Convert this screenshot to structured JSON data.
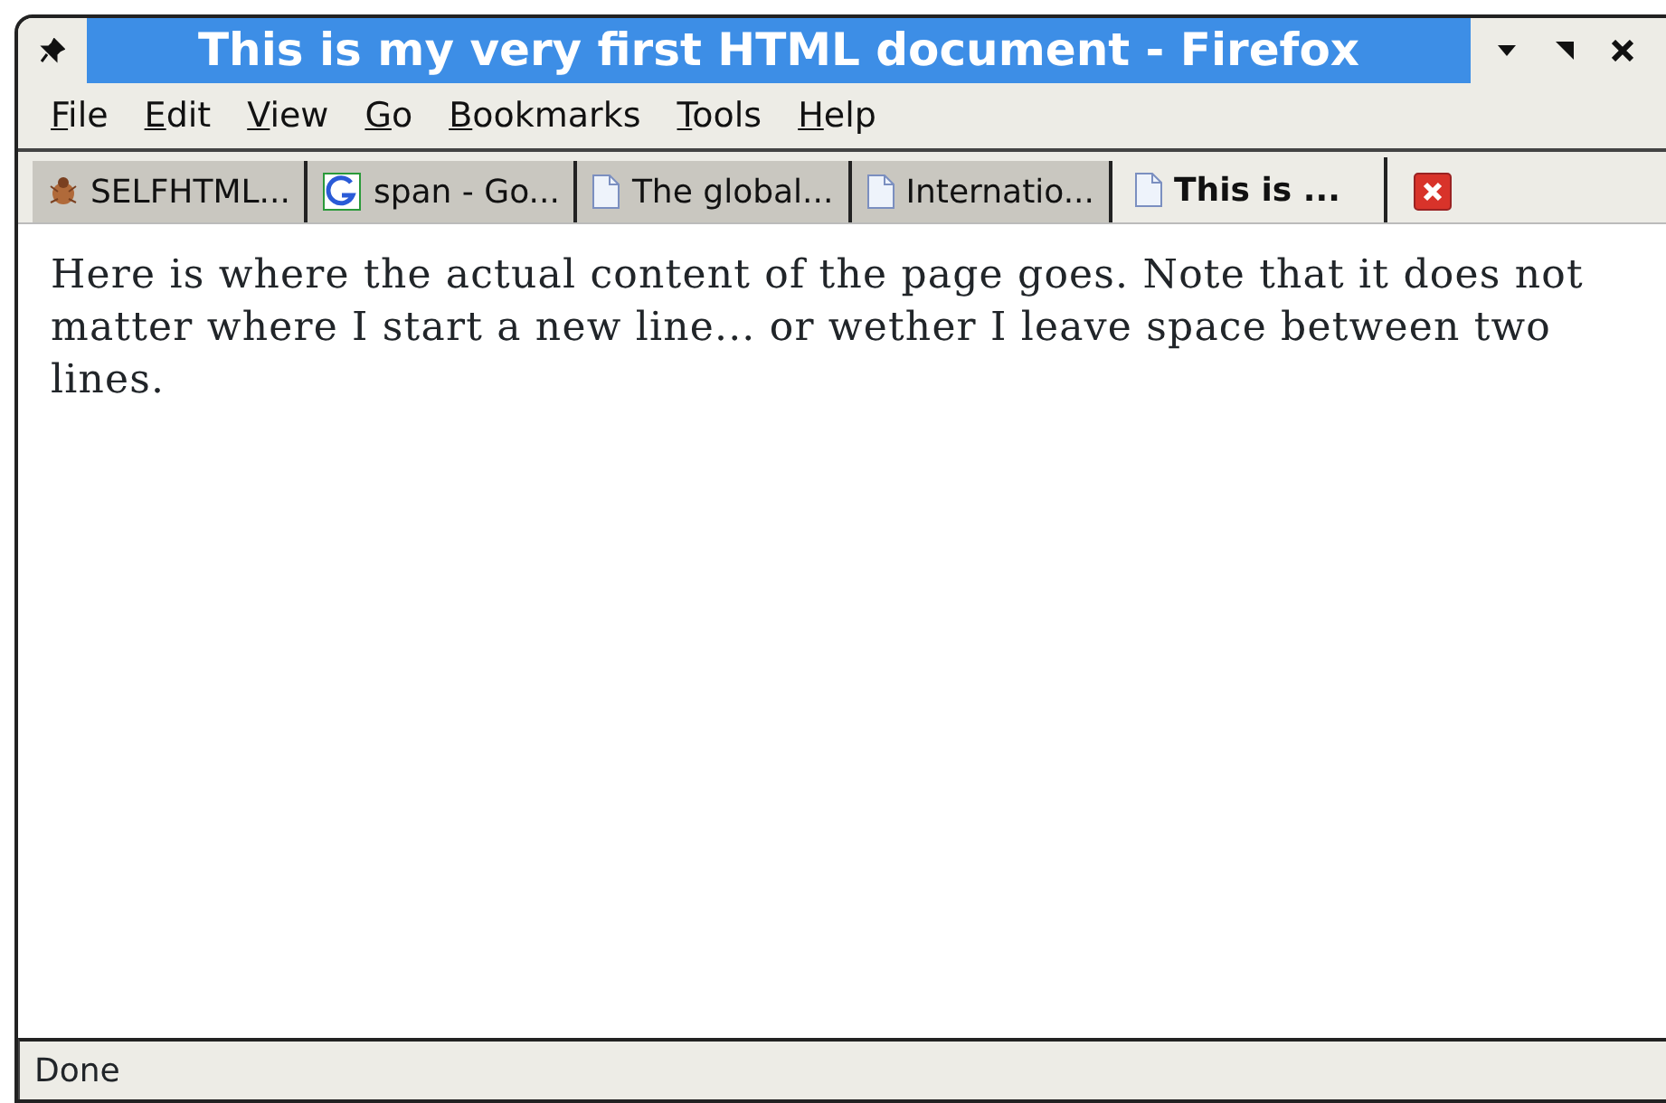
{
  "window": {
    "title": "This is my very first HTML document - Firefox"
  },
  "menu": [
    {
      "label": "File"
    },
    {
      "label": "Edit"
    },
    {
      "label": "View"
    },
    {
      "label": "Go"
    },
    {
      "label": "Bookmarks"
    },
    {
      "label": "Tools"
    },
    {
      "label": "Help"
    }
  ],
  "tabs": [
    {
      "label": "SELFHTML...",
      "kind": "site",
      "selected": false
    },
    {
      "label": "span - Go...",
      "kind": "search",
      "selected": false
    },
    {
      "label": "The global...",
      "kind": "page",
      "selected": false
    },
    {
      "label": "Internatio...",
      "kind": "page",
      "selected": false
    },
    {
      "label": "This is ...",
      "kind": "page",
      "selected": true
    }
  ],
  "content": {
    "text": "Here is where the actual content of the page goes. Note that it does not matter where I start a new line... or wether I leave space between two lines."
  },
  "status_bar": {
    "text": "Done"
  }
}
